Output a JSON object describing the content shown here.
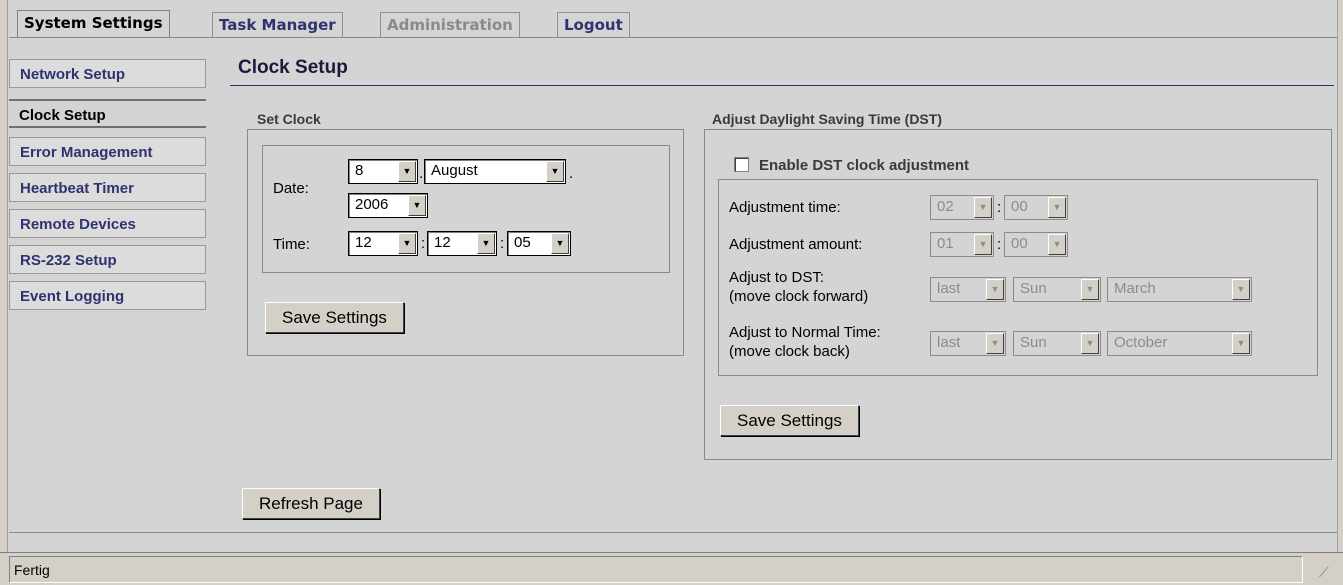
{
  "tabs": [
    {
      "label": "System Settings",
      "state": "active"
    },
    {
      "label": "Task Manager",
      "state": "normal"
    },
    {
      "label": "Administration",
      "state": "disabled"
    },
    {
      "label": "Logout",
      "state": "normal"
    }
  ],
  "sidebar": {
    "items": [
      {
        "label": "Network Setup"
      },
      {
        "label": "Clock Setup",
        "active": true
      },
      {
        "label": "Error Management"
      },
      {
        "label": "Heartbeat Timer"
      },
      {
        "label": "Remote Devices"
      },
      {
        "label": "RS-232 Setup"
      },
      {
        "label": "Event Logging"
      }
    ]
  },
  "page": {
    "title": "Clock Setup"
  },
  "set_clock": {
    "section_label": "Set Clock",
    "date_label": "Date:",
    "time_label": "Time:",
    "day": "8",
    "month": "August",
    "year": "2006",
    "hour": "12",
    "minute": "12",
    "second": "05",
    "date_sep_1": ".",
    "date_sep_2": ".",
    "time_sep": ":",
    "save_label": "Save Settings"
  },
  "dst": {
    "section_label": "Adjust Daylight Saving Time (DST)",
    "enable_label": "Enable DST clock adjustment",
    "enabled": false,
    "adj_time_label": "Adjustment time:",
    "adj_time_hour": "02",
    "adj_time_min": "00",
    "adj_amount_label": "Adjustment amount:",
    "adj_amount_hour": "01",
    "adj_amount_min": "00",
    "to_dst_label_1": "Adjust to DST:",
    "to_dst_label_2": "(move clock forward)",
    "to_dst_week": "last",
    "to_dst_day": "Sun",
    "to_dst_month": "March",
    "to_normal_label_1": "Adjust to Normal Time:",
    "to_normal_label_2": "(move clock back)",
    "to_normal_week": "last",
    "to_normal_day": "Sun",
    "to_normal_month": "October",
    "save_label": "Save Settings"
  },
  "refresh_label": "Refresh Page",
  "status": {
    "text": "Fertig"
  }
}
